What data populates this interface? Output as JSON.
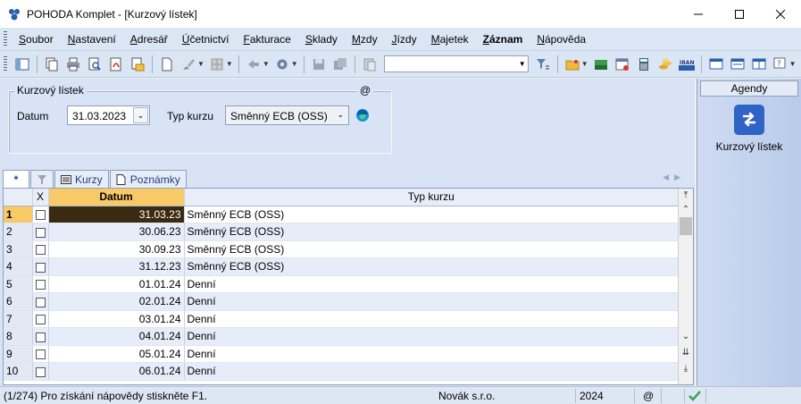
{
  "window": {
    "title": "POHODA Komplet - [Kurzový lístek]"
  },
  "menu": [
    "Soubor",
    "Nastavení",
    "Adresář",
    "Účetnictví",
    "Fakturace",
    "Sklady",
    "Mzdy",
    "Jízdy",
    "Majetek",
    "Záznam",
    "Nápověda"
  ],
  "menu_bold_index": 9,
  "form": {
    "group_title": "Kurzový lístek",
    "at_label": "@",
    "datum_label": "Datum",
    "datum_value": "31.03.2023",
    "typ_label": "Typ kurzu",
    "typ_value": "Směnný ECB (OSS)"
  },
  "tabs": {
    "star": "*",
    "kurzy": "Kurzy",
    "poznamky": "Poznámky"
  },
  "grid": {
    "columns": {
      "x": "X",
      "datum": "Datum",
      "typ": "Typ kurzu"
    },
    "rows": [
      {
        "n": "1",
        "datum": "31.03.23",
        "typ": "Směnný ECB (OSS)"
      },
      {
        "n": "2",
        "datum": "30.06.23",
        "typ": "Směnný ECB (OSS)"
      },
      {
        "n": "3",
        "datum": "30.09.23",
        "typ": "Směnný ECB (OSS)"
      },
      {
        "n": "4",
        "datum": "31.12.23",
        "typ": "Směnný ECB (OSS)"
      },
      {
        "n": "5",
        "datum": "01.01.24",
        "typ": "Denní"
      },
      {
        "n": "6",
        "datum": "02.01.24",
        "typ": "Denní"
      },
      {
        "n": "7",
        "datum": "03.01.24",
        "typ": "Denní"
      },
      {
        "n": "8",
        "datum": "04.01.24",
        "typ": "Denní"
      },
      {
        "n": "9",
        "datum": "05.01.24",
        "typ": "Denní"
      },
      {
        "n": "10",
        "datum": "06.01.24",
        "typ": "Denní"
      }
    ]
  },
  "agendy": {
    "header": "Agendy",
    "item": "Kurzový lístek"
  },
  "status": {
    "message": "(1/274) Pro získání nápovědy stiskněte F1.",
    "company": "Novák s.r.o.",
    "year": "2024",
    "at": "@"
  },
  "colors": {
    "accent": "#f7c967",
    "selected_cell": "#3a2a12",
    "panel": "#d8e3f6",
    "agenda_icon": "#2f63c6"
  }
}
